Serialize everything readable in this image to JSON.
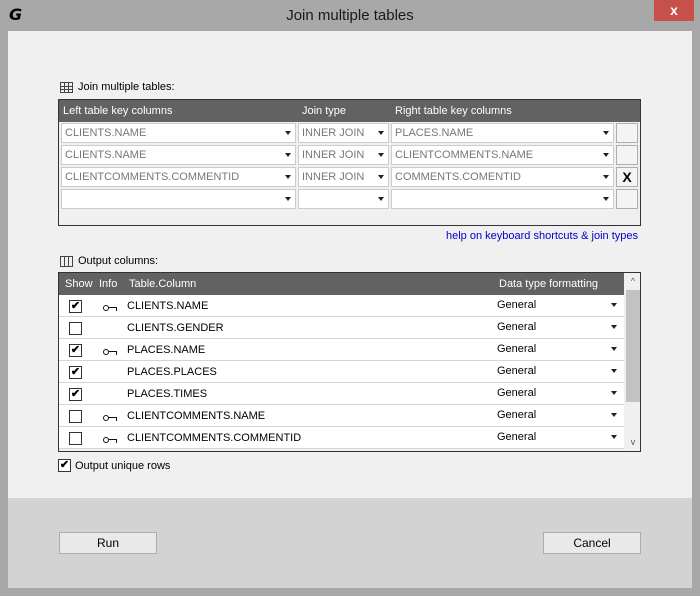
{
  "window": {
    "app_icon": "G",
    "title": "Join multiple tables",
    "close_glyph": "x"
  },
  "join_section": {
    "label": "Join multiple tables:",
    "headers": [
      "Left table key columns",
      "Join type",
      "Right table key columns"
    ],
    "rows": [
      {
        "left": "CLIENTS.NAME",
        "join": "INNER JOIN",
        "right": "PLACES.NAME",
        "delete": ""
      },
      {
        "left": "CLIENTS.NAME",
        "join": "INNER JOIN",
        "right": "CLIENTCOMMENTS.NAME",
        "delete": ""
      },
      {
        "left": "CLIENTCOMMENTS.COMMENTID",
        "join": "INNER JOIN",
        "right": "COMMENTS.COMENTID",
        "delete": "X"
      },
      {
        "left": "",
        "join": "",
        "right": "",
        "delete": ""
      }
    ]
  },
  "help_link": "help on keyboard shortcuts & join types",
  "output_section": {
    "label": "Output columns:",
    "headers": [
      "Show",
      "Info",
      "Table.Column",
      "Data type formatting"
    ],
    "rows": [
      {
        "show": true,
        "key": true,
        "column": "CLIENTS.NAME",
        "format": "General"
      },
      {
        "show": false,
        "key": false,
        "column": "CLIENTS.GENDER",
        "format": "General"
      },
      {
        "show": true,
        "key": true,
        "column": "PLACES.NAME",
        "format": "General"
      },
      {
        "show": true,
        "key": false,
        "column": "PLACES.PLACES",
        "format": "General"
      },
      {
        "show": true,
        "key": false,
        "column": "PLACES.TIMES",
        "format": "General"
      },
      {
        "show": false,
        "key": true,
        "column": "CLIENTCOMMENTS.NAME",
        "format": "General"
      },
      {
        "show": false,
        "key": true,
        "column": "CLIENTCOMMENTS.COMMENTID",
        "format": "General"
      }
    ],
    "scroll_up": "^",
    "scroll_down": "v"
  },
  "unique_rows": {
    "label": "Output unique rows",
    "checked": true
  },
  "buttons": {
    "run": "Run",
    "cancel": "Cancel"
  },
  "check_glyph": "✔"
}
